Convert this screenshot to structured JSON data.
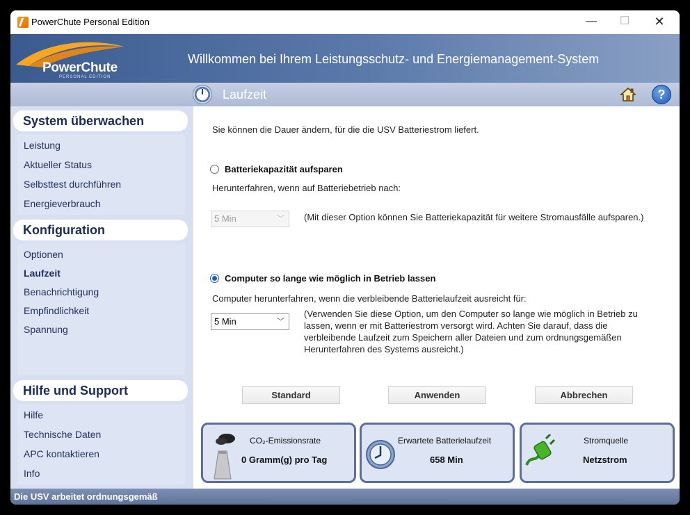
{
  "window": {
    "title": "PowerChute Personal Edition",
    "controls": {
      "minimize": "—",
      "maximize": "☐",
      "close": "✕"
    }
  },
  "header": {
    "logo_text": "PowerChute",
    "logo_subtext": "PERSONAL EDITION",
    "welcome": "Willkommen bei Ihrem Leistungsschutz- und Energiemanagement-System"
  },
  "section": {
    "title": "Laufzeit",
    "help_label": "?"
  },
  "sidebar": {
    "groups": [
      {
        "title": "System überwachen",
        "items": [
          "Leistung",
          "Aktueller Status",
          "Selbsttest durchführen",
          "Energieverbrauch"
        ]
      },
      {
        "title": "Konfiguration",
        "items": [
          "Optionen",
          "Laufzeit",
          "Benachrichtigung",
          "Empfindlichkeit",
          "Spannung"
        ]
      },
      {
        "title": "Hilfe und Support",
        "items": [
          "Hilfe",
          "Technische Daten",
          "APC kontaktieren",
          "Info"
        ]
      }
    ],
    "active_item": "Laufzeit"
  },
  "main": {
    "intro": "Sie können die Dauer ändern, für die die USV Batteriestrom liefert.",
    "option1": {
      "label": "Batteriekapazität aufsparen",
      "selected": false,
      "description": "Herunterfahren, wenn auf Batteriebetrieb nach:",
      "select_value": "5 Min",
      "note": "(Mit dieser Option können Sie Batteriekapazität für weitere Stromausfälle aufsparen.)"
    },
    "option2": {
      "label": "Computer so lange wie möglich in Betrieb lassen",
      "selected": true,
      "description": "Computer herunterfahren, wenn die verbleibende Batterielaufzeit ausreicht für:",
      "select_value": "5 Min",
      "note_lines": [
        "(Verwenden Sie diese Option, um den Computer so lange wie möglich in Betrieb zu",
        "lassen, wenn er mit Batteriestrom versorgt wird. Achten Sie darauf, dass die",
        "verbleibende Laufzeit zum Speichern aller Dateien und zum ordnungsgemäßen",
        "Herunterfahren des Systems ausreicht.)"
      ]
    },
    "buttons": {
      "standard": "Standard",
      "apply": "Anwenden",
      "cancel": "Abbrechen"
    }
  },
  "cards": {
    "co2": {
      "label": "CO₂-Emissionsrate",
      "value": "0 Gramm(g) pro Tag"
    },
    "runtime": {
      "label": "Erwartete Batterielaufzeit",
      "value": "658 Min"
    },
    "power": {
      "label": "Stromquelle",
      "value": "Netzstrom"
    }
  },
  "status": {
    "text": "Die USV arbeitet ordnungsgemäß"
  },
  "colors": {
    "header_blue": "#3b5a8f",
    "accent": "#1b5fcf",
    "sidebar_bg": "#d7dff0",
    "card_border": "#5d6f98"
  }
}
